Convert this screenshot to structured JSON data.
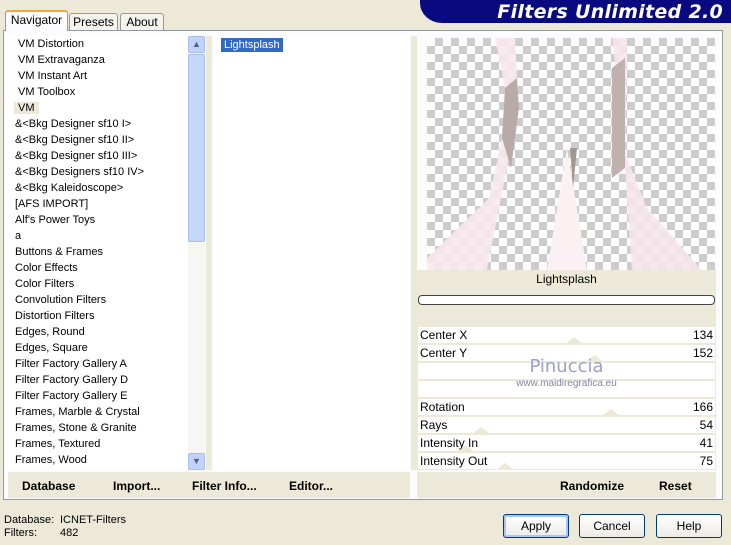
{
  "banner": {
    "title": "Filters Unlimited 2.0"
  },
  "tabs": [
    {
      "label": "Navigator",
      "active": true
    },
    {
      "label": "Presets"
    },
    {
      "label": "About"
    }
  ],
  "categories": {
    "selected": "VM",
    "items": [
      "VM Distortion",
      "VM Extravaganza",
      "VM Instant Art",
      "VM Toolbox",
      "VM",
      "&<Bkg Designer sf10 I>",
      "&<Bkg Designer sf10 II>",
      "&<Bkg Designer sf10 III>",
      "&<Bkg Designers sf10 IV>",
      "&<Bkg Kaleidoscope>",
      "[AFS IMPORT]",
      "Alf's Power Toys",
      "a",
      "Buttons & Frames",
      "Color Effects",
      "Color Filters",
      "Convolution Filters",
      "Distortion Filters",
      "Edges, Round",
      "Edges, Square",
      "Filter Factory Gallery A",
      "Filter Factory Gallery D",
      "Filter Factory Gallery E",
      "Frames, Marble & Crystal",
      "Frames, Stone & Granite",
      "Frames, Textured",
      "Frames, Wood"
    ]
  },
  "filters": {
    "items": [
      "Lightsplash"
    ],
    "selected": "Lightsplash"
  },
  "filter_title": "Lightsplash",
  "progress": 0,
  "params": [
    {
      "label": "Center X",
      "value": 134
    },
    {
      "label": "Center Y",
      "value": 152
    },
    {
      "label": "",
      "value": null
    },
    {
      "label": "",
      "value": null
    },
    {
      "label": "Rotation",
      "value": 166
    },
    {
      "label": "Rays",
      "value": 54
    },
    {
      "label": "Intensity In",
      "value": 41
    },
    {
      "label": "Intensity Out",
      "value": 75
    }
  ],
  "watermark": {
    "name": "Pinuccia",
    "url": "www.maidiregrafica.eu"
  },
  "left_buttons": [
    "Database",
    "Import...",
    "Filter Info...",
    "Editor..."
  ],
  "right_buttons": [
    "Randomize",
    "Reset"
  ],
  "status": {
    "database_label": "Database:",
    "database": "ICNET-Filters",
    "filters_label": "Filters:",
    "filters": "482"
  },
  "dialog_buttons": {
    "apply": "Apply",
    "cancel": "Cancel",
    "help": "Help"
  }
}
